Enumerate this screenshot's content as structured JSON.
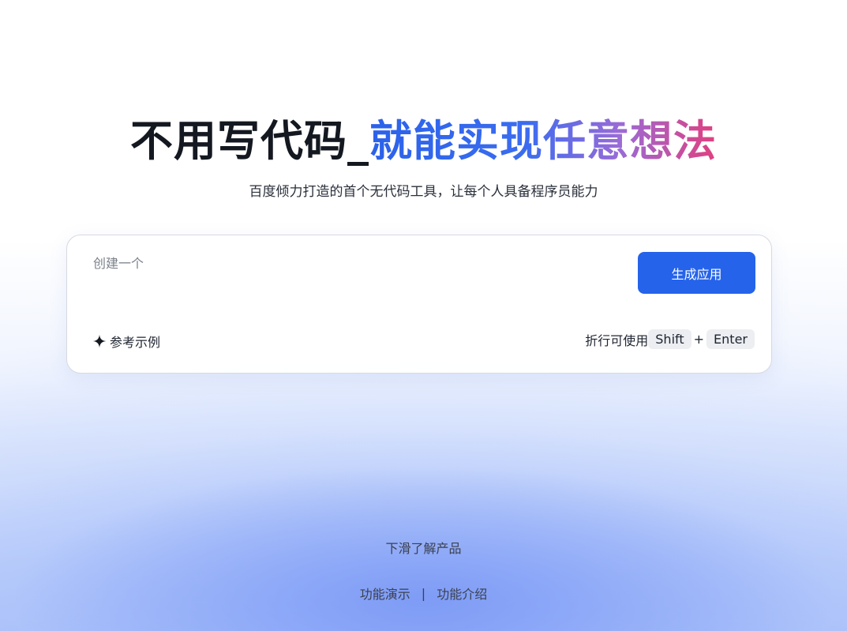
{
  "hero": {
    "title_plain": "不用写代码_",
    "title_gradient": "就能实现任意想法",
    "subtitle": "百度倾力打造的首个无代码工具，让每个人具备程序员能力"
  },
  "prompt": {
    "placeholder": "创建一个",
    "value": "",
    "generate_label": "生成应用",
    "examples_label": "参考示例",
    "hint_text": "折行可使用",
    "hint_key1": "Shift",
    "hint_plus": "+",
    "hint_key2": "Enter"
  },
  "footer": {
    "scroll_hint": "下滑了解产品",
    "links": [
      "功能演示",
      "功能介绍"
    ],
    "separator": "|"
  },
  "colors": {
    "accent": "#2563eb",
    "gradient_start": "#2b62ea",
    "gradient_mid": "#9a6bd6",
    "gradient_end": "#e0407f"
  },
  "icons": {
    "examples": "sparkle-icon"
  }
}
